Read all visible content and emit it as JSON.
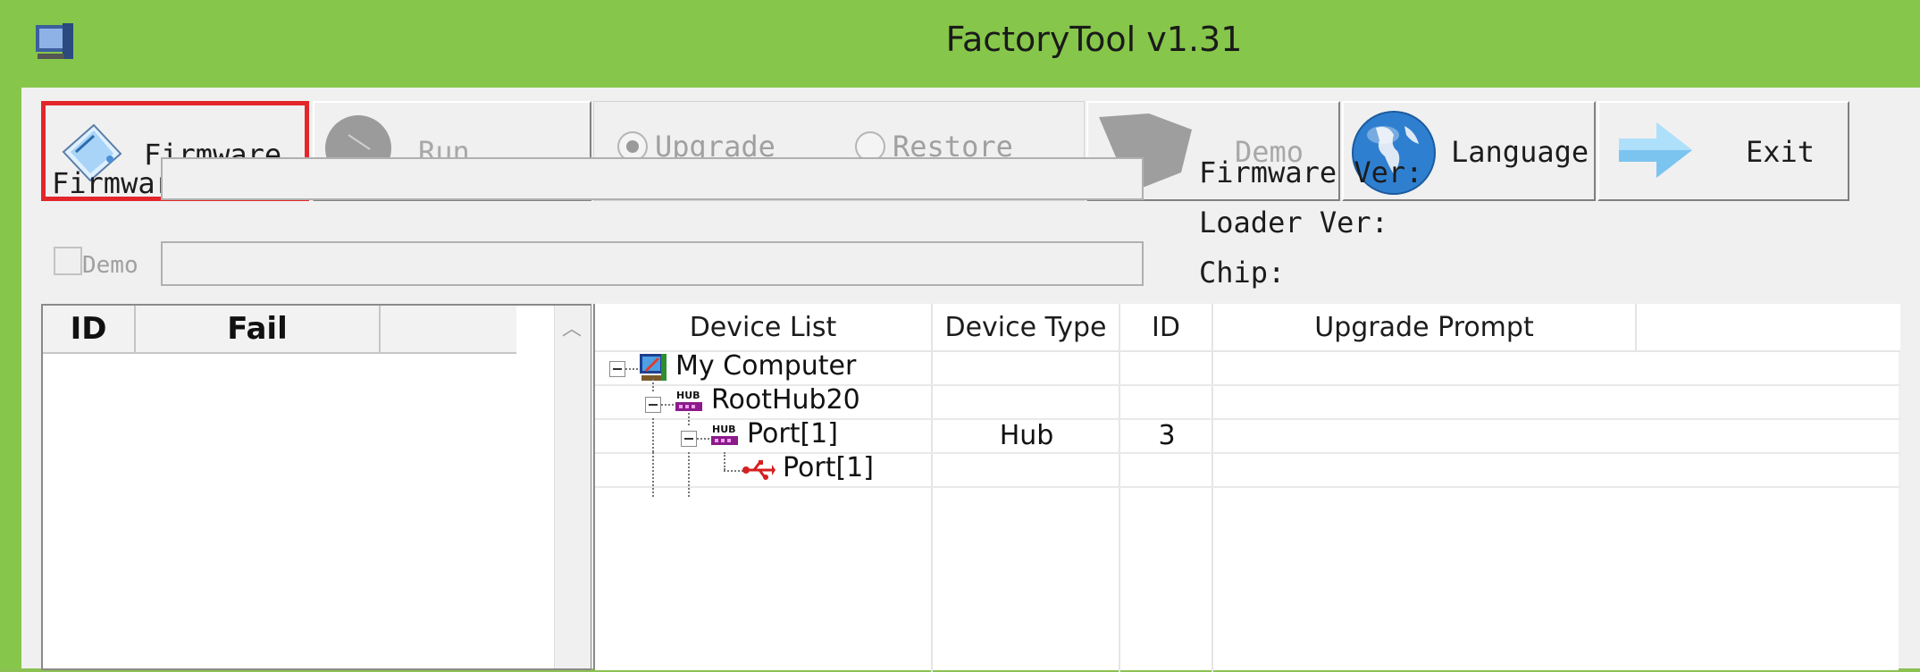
{
  "window": {
    "title": "FactoryTool v1.31"
  },
  "toolbar": {
    "firmware_label": "Firmware",
    "run_label": "Run",
    "upgrade_label": "Upgrade",
    "restore_label": "Restore",
    "demo_label": "Demo",
    "language_label": "Language",
    "exit_label": "Exit"
  },
  "fields": {
    "firmware_label": "Firmware",
    "demo_checkbox_label": "Demo",
    "firmware_ver_label": "Firmware Ver:",
    "loader_ver_label": "Loader Ver:",
    "chip_label": "Chip:"
  },
  "fail_table": {
    "columns": [
      "ID",
      "Fail"
    ]
  },
  "device_table": {
    "columns": [
      "Device List",
      "Device Type",
      "ID",
      "Upgrade Prompt"
    ],
    "rows": [
      {
        "name": "My Computer",
        "type": "",
        "id": "",
        "prompt": ""
      },
      {
        "name": "RootHub20",
        "type": "",
        "id": "",
        "prompt": ""
      },
      {
        "name": "Port[1]",
        "type": "Hub",
        "id": "3",
        "prompt": ""
      },
      {
        "name": "Port[1]",
        "type": "",
        "id": "",
        "prompt": ""
      }
    ]
  },
  "icons": {
    "app": "app-icon",
    "firmware": "firmware-icon",
    "run": "run-icon",
    "demo": "demo-icon",
    "language": "globe-icon",
    "exit": "arrow-right-icon",
    "computer": "computer-icon",
    "hub": "hub-icon",
    "usb": "usb-icon"
  },
  "colors": {
    "titlebar": "#86c64a",
    "highlight": "#e3262b",
    "hub": "#8b1a8b",
    "usb": "#d42020"
  }
}
